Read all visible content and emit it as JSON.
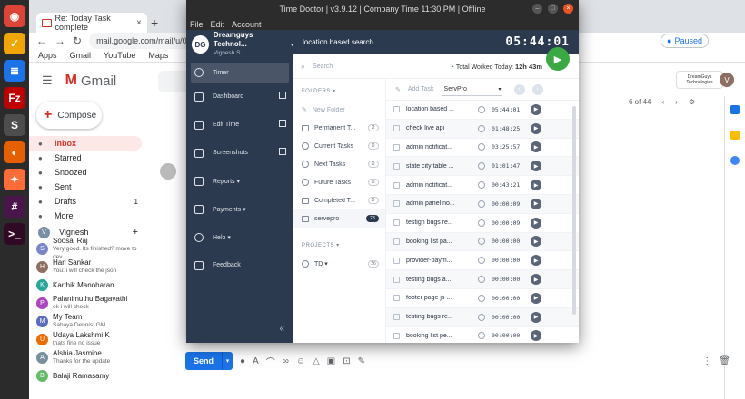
{
  "dock": {
    "apps": [
      {
        "name": "chrome-icon",
        "color": "#db4437",
        "glyph": "◉"
      },
      {
        "name": "timedoctor-icon",
        "color": "#f0a500",
        "glyph": "✓"
      },
      {
        "name": "docs-icon",
        "color": "#1a73e8",
        "glyph": "≣"
      },
      {
        "name": "filezilla-icon",
        "color": "#bf0000",
        "glyph": "Fz"
      },
      {
        "name": "sublime-icon",
        "color": "#4d4d4d",
        "glyph": "S"
      },
      {
        "name": "firefox-icon",
        "color": "#e66000",
        "glyph": "◐"
      },
      {
        "name": "postman-icon",
        "color": "#ff6c37",
        "glyph": "✦"
      },
      {
        "name": "slack-icon",
        "color": "#4a154b",
        "glyph": "#"
      },
      {
        "name": "terminal-icon",
        "color": "#300a24",
        "glyph": ">_"
      }
    ]
  },
  "browser": {
    "tab_title": "Re: Today Task complete",
    "new_tab": "+",
    "url": "mail.google.com/mail/u/0/#inb",
    "profile_status": "Paused",
    "bookmarks": [
      "Apps",
      "Gmail",
      "YouTube",
      "Maps"
    ]
  },
  "gmail": {
    "product": "Gmail",
    "compose": "Compose",
    "nav": [
      {
        "label": "Inbox",
        "count": "",
        "active": true
      },
      {
        "label": "Starred",
        "count": ""
      },
      {
        "label": "Snoozed",
        "count": ""
      },
      {
        "label": "Sent",
        "count": ""
      },
      {
        "label": "Drafts",
        "count": "1"
      },
      {
        "label": "More",
        "count": ""
      }
    ],
    "chat_owner": "Vignesh",
    "chats": [
      {
        "initial": "S",
        "name": "Soosai Raj",
        "msg": "Very good. Its finished? move to dev"
      },
      {
        "initial": "H",
        "name": "Hari Sankar",
        "msg": "You: i will check the json"
      },
      {
        "initial": "K",
        "name": "Karthik Manoharan",
        "msg": ""
      },
      {
        "initial": "P",
        "name": "Palanimuthu Bagavathi",
        "msg": "ok i will check"
      },
      {
        "initial": "M",
        "name": "My Team",
        "msg": "Sahaya Dennis: GM"
      },
      {
        "initial": "U",
        "name": "Udaya Lakshmi K",
        "msg": "thats fine no issue"
      },
      {
        "initial": "A",
        "name": "Alshia Jasmine",
        "msg": "Thanks for the update"
      },
      {
        "initial": "B",
        "name": "Balaji Ramasamy",
        "msg": ""
      }
    ],
    "pager": "6 of 44",
    "send": "Send",
    "account_brand": "DreamGuys Technologies",
    "account_initial": "V"
  },
  "timedoctor": {
    "window_title": "Time Doctor | v3.9.12 | Company Time 11:30 PM | Offline",
    "menu": [
      "File",
      "Edit",
      "Account"
    ],
    "account_name": "Dreamguys Technol...",
    "account_user": "Vignesh S",
    "nav": [
      {
        "label": "Timer",
        "active": true
      },
      {
        "label": "Dashboard"
      },
      {
        "label": "Edit Time"
      },
      {
        "label": "Screenshots"
      },
      {
        "label": "Reports ▾"
      },
      {
        "label": "Payments ▾"
      },
      {
        "label": "Help ▾"
      },
      {
        "label": "Feedback"
      }
    ],
    "collapse": "«",
    "current_task": "location based search",
    "clock": "05:44:01",
    "search_placeholder": "Search",
    "worked_label": "Total Worked Today:",
    "worked_value": "12h 43m",
    "folders_title": "FOLDERS ▾",
    "new_folder": "New Folder",
    "folders": [
      {
        "label": "Permanent T...",
        "count": "2"
      },
      {
        "label": "Current Tasks",
        "count": "0"
      },
      {
        "label": "Next Tasks",
        "count": "0"
      },
      {
        "label": "Future Tasks",
        "count": "0"
      },
      {
        "label": "Completed T...",
        "count": "0"
      },
      {
        "label": "servepro",
        "count": "23",
        "selected": true
      }
    ],
    "projects_title": "PROJECTS ▾",
    "projects": [
      {
        "label": "TD ▾",
        "count": "26"
      }
    ],
    "add_task": "Add Task",
    "project_select": "ServPro",
    "tasks": [
      {
        "name": "location based ...",
        "time": "05:44:01"
      },
      {
        "name": "check live api",
        "time": "01:48:25"
      },
      {
        "name": "admin notificat...",
        "time": "03:25:57"
      },
      {
        "name": "state city table ...",
        "time": "01:01:47"
      },
      {
        "name": "admin notificat...",
        "time": "00:43:21"
      },
      {
        "name": "admin panel no...",
        "time": "00:00:09"
      },
      {
        "name": "testign bugs re...",
        "time": "00:00:09"
      },
      {
        "name": "booking list pa...",
        "time": "00:00:00"
      },
      {
        "name": "provider-paym...",
        "time": "00:00:00"
      },
      {
        "name": "testing bugs a...",
        "time": "00:00:00"
      },
      {
        "name": "footer page js ...",
        "time": "00:00:00"
      },
      {
        "name": "testing bugs re...",
        "time": "00:00:00"
      },
      {
        "name": "booking list pe...",
        "time": "00:00:00"
      }
    ]
  }
}
